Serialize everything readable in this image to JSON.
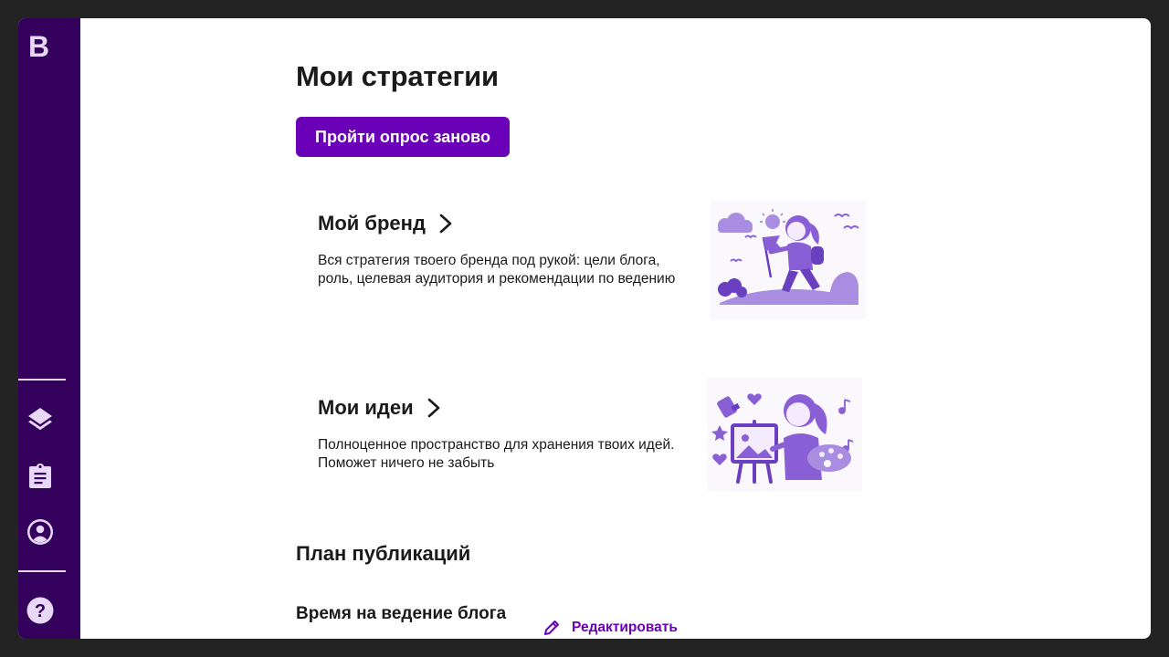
{
  "sidebar": {
    "logo_letter": "B",
    "items": [
      {
        "name": "layers",
        "icon": "layers-icon"
      },
      {
        "name": "clipboard",
        "icon": "clipboard-list-icon"
      },
      {
        "name": "profile",
        "icon": "account-circle-icon"
      },
      {
        "name": "help",
        "icon": "help-circle-icon"
      }
    ]
  },
  "main": {
    "title": "Мои стратегии",
    "retake_button": "Пройти опрос заново",
    "cards": [
      {
        "title": "Мой бренд",
        "description": "Вся стратегия твоего бренда под рукой: цели блога, роль, целевая аудитория и рекомендации по ведению",
        "illustration": "girl-hiking-with-flag-illustration"
      },
      {
        "title": "Мои идеи",
        "description": "Полноценное пространство для хранения твоих идей. Поможет ничего не забыть",
        "illustration": "girl-painting-at-easel-illustration"
      }
    ],
    "publication_plan": {
      "title": "План публикаций",
      "blog_time_title": "Время на ведение блога",
      "edit_label": "Редактировать"
    }
  },
  "colors": {
    "sidebar_bg": "#33005c",
    "accent": "#6a00b8",
    "icon_light": "#e8d8f8",
    "illustration": "#8a5fd6",
    "frame": "#232323"
  }
}
